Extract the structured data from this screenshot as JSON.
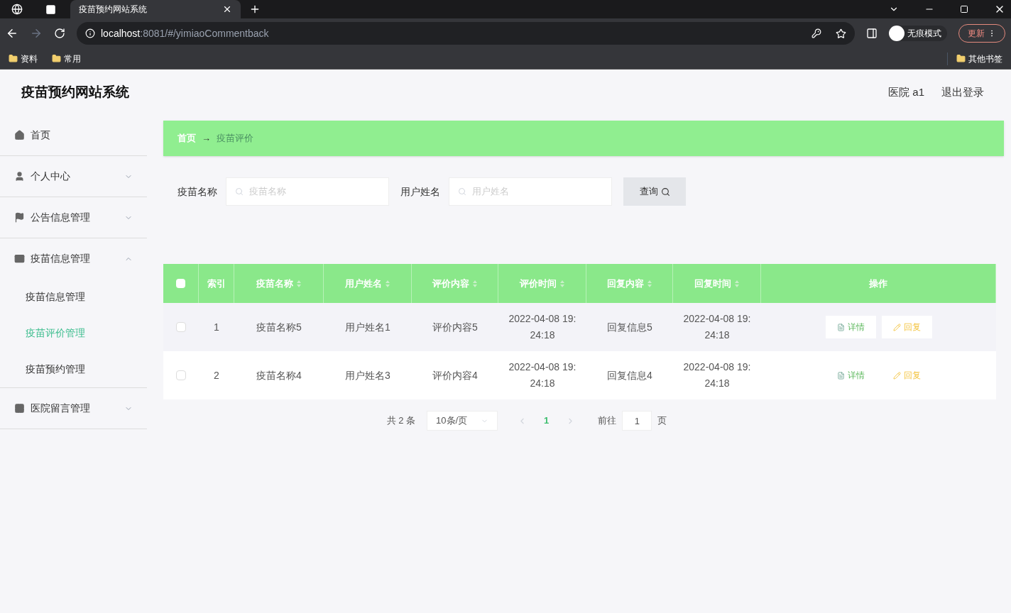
{
  "browser": {
    "tab_title": "疫苗预约网站系统",
    "url_host": "localhost",
    "url_path": ":8081/#/yimiaoCommentback",
    "profile": "无痕模式",
    "update": "更新",
    "bookmarks": [
      "资料",
      "常用"
    ],
    "other_bookmarks": "其他书签"
  },
  "header": {
    "title": "疫苗预约网站系统",
    "user": "医院 a1",
    "logout": "退出登录"
  },
  "sidebar": {
    "items": [
      {
        "label": "首页",
        "kind": "link"
      },
      {
        "label": "个人中心",
        "kind": "group",
        "expanded": false
      },
      {
        "label": "公告信息管理",
        "kind": "group",
        "expanded": false
      },
      {
        "label": "疫苗信息管理",
        "kind": "group",
        "expanded": true,
        "children": [
          {
            "label": "疫苗信息管理",
            "selected": false
          },
          {
            "label": "疫苗评价管理",
            "selected": true
          },
          {
            "label": "疫苗预约管理",
            "selected": false
          }
        ]
      },
      {
        "label": "医院留言管理",
        "kind": "group",
        "expanded": false
      }
    ]
  },
  "breadcrumb": {
    "home": "首页",
    "separator": "→",
    "current": "疫苗评价"
  },
  "search": {
    "fields": [
      {
        "label": "疫苗名称",
        "placeholder": "疫苗名称"
      },
      {
        "label": "用户姓名",
        "placeholder": "用户姓名"
      }
    ],
    "button": "查询"
  },
  "table": {
    "header_checked": false,
    "columns": [
      {
        "label": "索引",
        "sortable": false
      },
      {
        "label": "疫苗名称",
        "sortable": true
      },
      {
        "label": "用户姓名",
        "sortable": true
      },
      {
        "label": "评价内容",
        "sortable": true
      },
      {
        "label": "评价时间",
        "sortable": true
      },
      {
        "label": "回复内容",
        "sortable": true
      },
      {
        "label": "回复时间",
        "sortable": true
      },
      {
        "label": "操作",
        "sortable": false
      }
    ],
    "rows": [
      {
        "checked": false,
        "cells": [
          "1",
          "疫苗名称5",
          "用户姓名1",
          "评价内容5",
          "2022-04-08 19:24:18",
          "回复信息5",
          "2022-04-08 19:24:18"
        ],
        "actions": [
          "详情",
          "回复"
        ]
      },
      {
        "checked": false,
        "cells": [
          "2",
          "疫苗名称4",
          "用户姓名3",
          "评价内容4",
          "2022-04-08 19:24:18",
          "回复信息4",
          "2022-04-08 19:24:18"
        ],
        "actions": [
          "详情",
          "回复"
        ]
      }
    ]
  },
  "pagination": {
    "total": "共 2 条",
    "page_size": "10条/页",
    "pages": [
      {
        "label": "1",
        "selected": true
      }
    ],
    "goto_label": "前往",
    "goto_value": "1",
    "goto_suffix": "页"
  }
}
